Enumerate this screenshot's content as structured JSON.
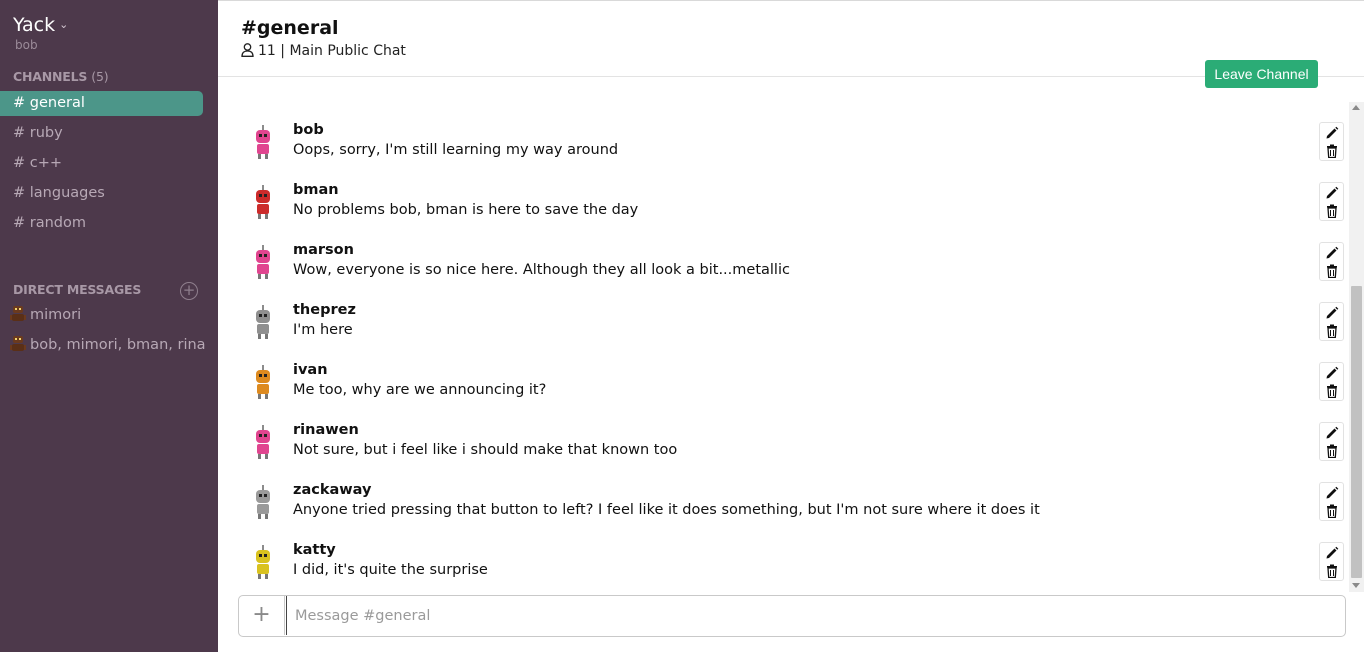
{
  "workspace": {
    "name": "Yack",
    "caret": "⌄",
    "user": "bob"
  },
  "channels": {
    "heading": "CHANNELS",
    "count": "(5)",
    "items": [
      {
        "label": "# general",
        "active": true
      },
      {
        "label": "# ruby"
      },
      {
        "label": "# c++"
      },
      {
        "label": "# languages"
      },
      {
        "label": "# random"
      }
    ]
  },
  "direct_messages": {
    "heading": "DIRECT MESSAGES",
    "add_icon": "plus-circle-icon",
    "items": [
      {
        "label": "mimori"
      },
      {
        "label": "bob, mimori, bman, rinawen"
      }
    ]
  },
  "header": {
    "title": "#general",
    "members": "11",
    "topic": "| Main Public Chat",
    "leave_label": "Leave Channel"
  },
  "messages": [
    {
      "author": "bob",
      "text": "Oops, sorry, I'm still learning my way around",
      "avatar_color": "#e0458f"
    },
    {
      "author": "bman",
      "text": "No problems bob, bman is here to save the day",
      "avatar_color": "#cc2b2b"
    },
    {
      "author": "marson",
      "text": "Wow, everyone is so nice here. Although they all look a bit...metallic",
      "avatar_color": "#e0458f"
    },
    {
      "author": "theprez",
      "text": "I'm here",
      "avatar_color": "#8f8f8f"
    },
    {
      "author": "ivan",
      "text": "Me too, why are we announcing it?",
      "avatar_color": "#dd8a1f"
    },
    {
      "author": "rinawen",
      "text": "Not sure, but i feel like i should make that known too",
      "avatar_color": "#e0458f"
    },
    {
      "author": "zackaway",
      "text": "Anyone tried pressing that button to left? I feel like it does something, but I'm not sure where it does it",
      "avatar_color": "#9a9a9a"
    },
    {
      "author": "katty",
      "text": "I did, it's quite the surprise",
      "avatar_color": "#d9c21f"
    }
  ],
  "composer": {
    "plus": "+",
    "placeholder": "Message #general"
  },
  "colors": {
    "sidebar": "#4d394b",
    "active_channel": "#4c9689",
    "leave_button": "#2bac76"
  }
}
